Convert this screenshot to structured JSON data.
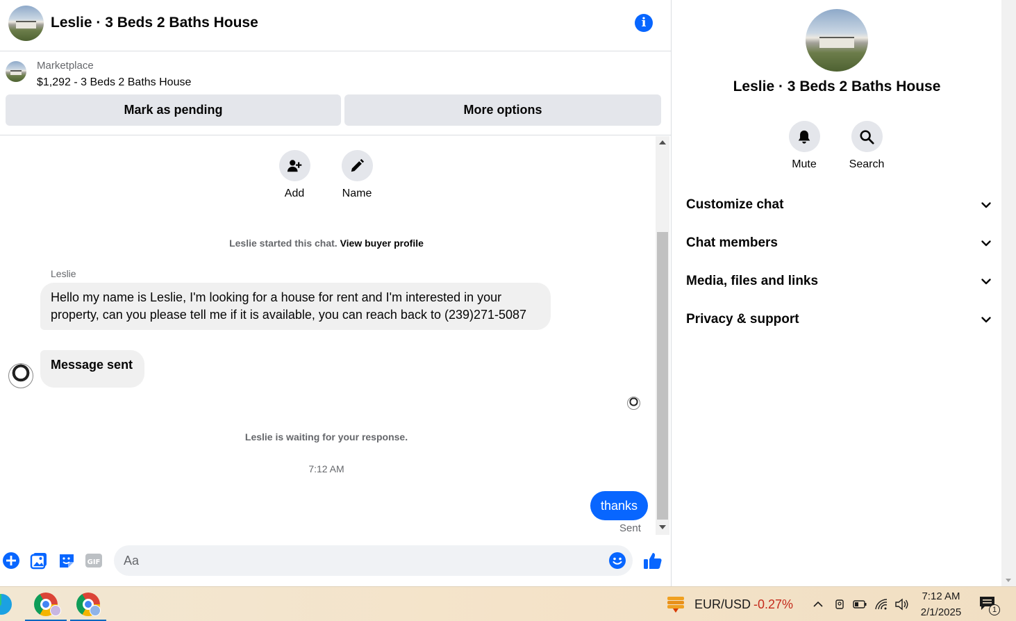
{
  "header": {
    "title": "Leslie · 3 Beds 2 Baths House",
    "info_icon": "info-icon"
  },
  "listing": {
    "source": "Marketplace",
    "description": "$1,292 - 3 Beds 2 Baths House",
    "mark_pending_label": "Mark as pending",
    "more_options_label": "More options"
  },
  "chat_actions": [
    {
      "label": "Add",
      "icon": "add-person-icon"
    },
    {
      "label": "Name",
      "icon": "pencil-icon"
    }
  ],
  "conversation": {
    "started_prefix": "Leslie started this chat.",
    "view_profile_link": "View buyer profile",
    "sender_name": "Leslie",
    "incoming_messages": [
      "Hello my name is Leslie, I'm looking for a house for rent and I'm interested in your property, can you please tell me if it is available, you can reach back to (239)271-5087",
      "Message sent"
    ],
    "waiting_text": "Leslie is waiting for your response.",
    "timestamp": "7:12 AM",
    "outgoing_message": "thanks",
    "outgoing_status": "Sent"
  },
  "composer": {
    "placeholder": "Aa",
    "icons": [
      "plus-icon",
      "photo-icon",
      "sticker-icon",
      "gif-icon",
      "emoji-icon",
      "thumbs-up-icon"
    ]
  },
  "details": {
    "title": "Leslie · 3 Beds 2 Baths House",
    "actions": [
      {
        "label": "Mute",
        "icon": "bell-icon"
      },
      {
        "label": "Search",
        "icon": "search-icon"
      }
    ],
    "sections": [
      {
        "label": "Customize chat"
      },
      {
        "label": "Chat members"
      },
      {
        "label": "Media, files and links"
      },
      {
        "label": "Privacy & support"
      }
    ]
  },
  "taskbar": {
    "ticker_symbol": "EUR/USD",
    "ticker_change": "-0.27%",
    "time": "7:12 AM",
    "date": "2/1/2025",
    "notification_count": "1"
  },
  "colors": {
    "messenger_blue": "#0866ff",
    "bubble_gray": "#f0f0f0",
    "button_gray": "#e4e6eb",
    "negative_red": "#c42b1c"
  }
}
